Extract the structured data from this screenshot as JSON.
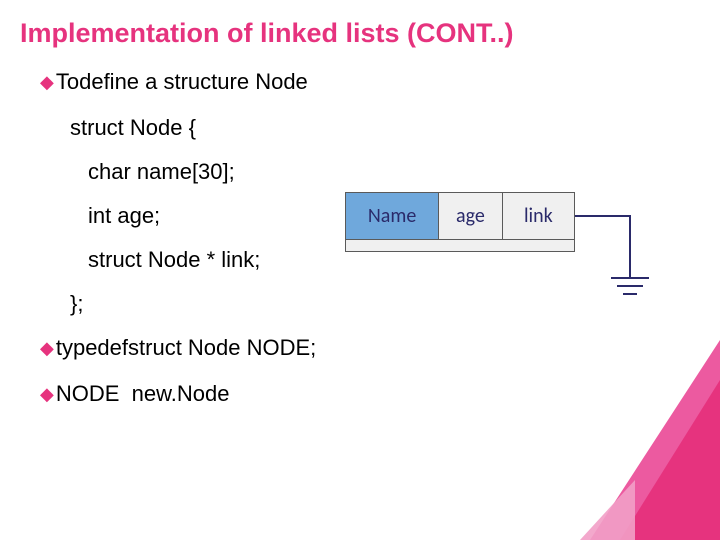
{
  "title": "Implementation of linked lists (CONT..)",
  "bullets": {
    "b1_prefix": "To",
    "b1_rest": " define a structure Node",
    "struct_open": "struct Node {",
    "line_name": "char name[30];",
    "line_age": "int age;",
    "line_link": "struct Node * link;",
    "struct_close": "};",
    "b2_prefix": "typedef",
    "b2_rest": " struct Node NODE;",
    "b3_prefix": "NODE",
    "b3_rest": "  new.Node"
  },
  "node": {
    "col_name": "Name",
    "col_age": "age",
    "col_link": "link"
  }
}
